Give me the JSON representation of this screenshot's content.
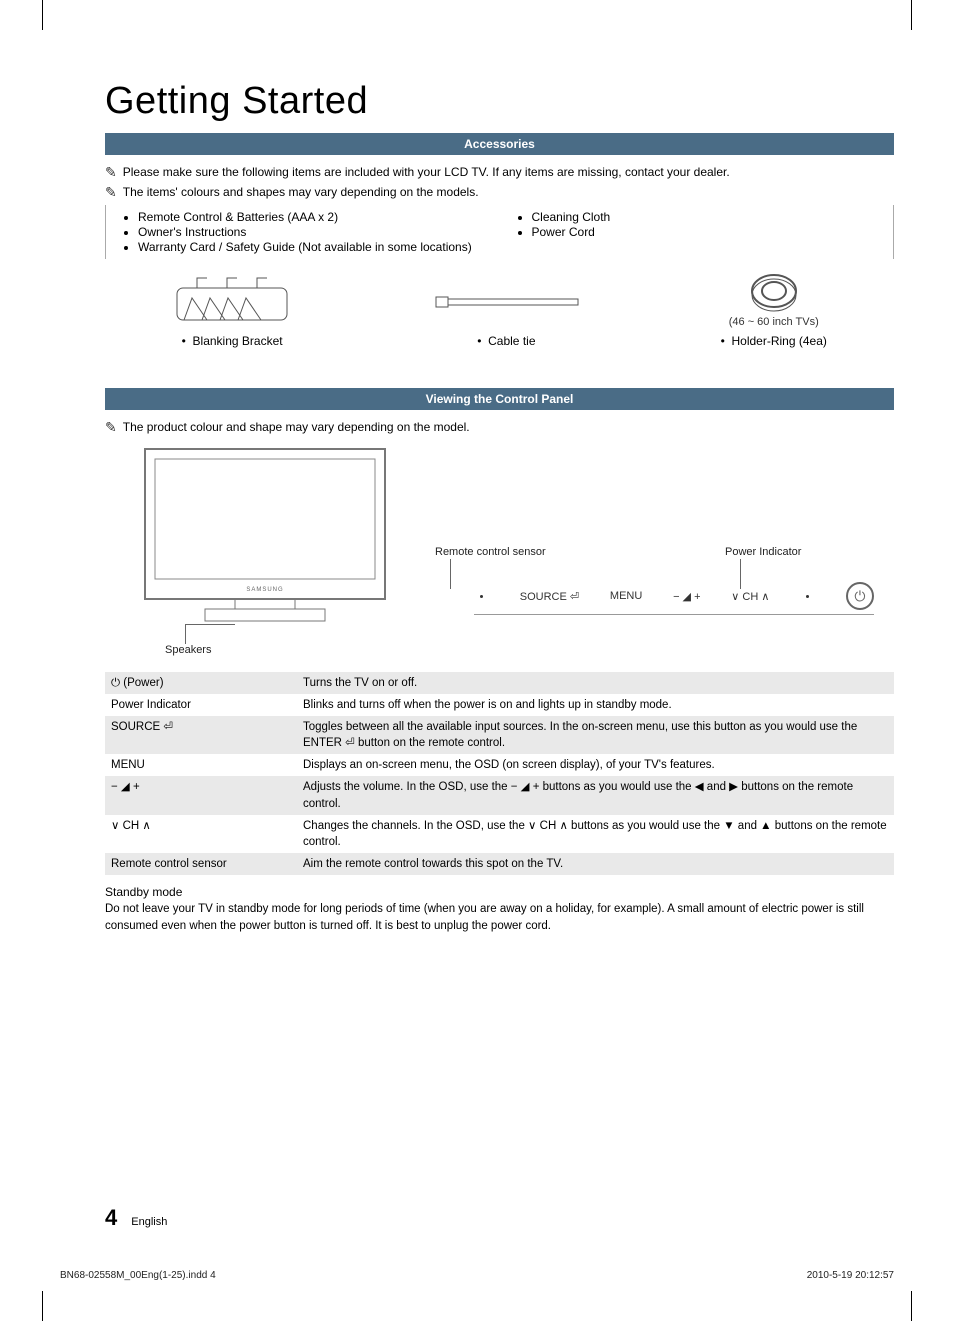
{
  "page_title": "Getting Started",
  "sections": {
    "accessories": {
      "heading": "Accessories",
      "notes": [
        "Please make sure the following items are included with your LCD TV. If any items are missing, contact your dealer.",
        "The items' colours and shapes may vary depending on the models."
      ],
      "left_items": [
        "Remote Control & Batteries (AAA x 2)",
        "Owner's Instructions",
        "Warranty Card / Safety Guide (Not available in some locations)"
      ],
      "right_items": [
        "Cleaning Cloth",
        "Power Cord"
      ],
      "illustrations": [
        {
          "caption": "Blanking Bracket",
          "sub": ""
        },
        {
          "caption": "Cable tie",
          "sub": ""
        },
        {
          "caption": "Holder-Ring (4ea)",
          "sub": "(46 ~ 60 inch TVs)"
        }
      ]
    },
    "control_panel": {
      "heading": "Viewing the Control Panel",
      "note": "The product colour and shape may vary depending on the model.",
      "labels": {
        "remote_sensor": "Remote control sensor",
        "power_indicator": "Power Indicator",
        "speakers": "Speakers",
        "source": "SOURCE",
        "menu": "MENU",
        "ch": "CH"
      },
      "table": [
        {
          "label": "⏻ (Power)",
          "desc": "Turns the TV on or off."
        },
        {
          "label": "Power Indicator",
          "desc": "Blinks and turns off when the power is on and lights up in standby mode."
        },
        {
          "label": "SOURCE ⏎",
          "desc": "Toggles between all the available input sources. In the on-screen menu, use this button as you would use the ENTER ⏎ button on the remote control."
        },
        {
          "label": "MENU",
          "desc": "Displays an on-screen menu, the OSD (on screen display), of your TV's features."
        },
        {
          "label": "− ◢ +",
          "desc": "Adjusts the volume. In the OSD, use the − ◢ + buttons as you would use the ◀ and ▶ buttons on the remote control."
        },
        {
          "label": "∨ CH ∧",
          "desc": "Changes the channels. In the OSD, use the ∨ CH ∧ buttons as you would use the ▼ and ▲ buttons on the remote control."
        },
        {
          "label": "Remote control sensor",
          "desc": "Aim the remote control towards this spot on the TV."
        }
      ],
      "standby": {
        "heading": "Standby mode",
        "body": "Do not leave your TV in standby mode for long periods of time (when you are away on a holiday, for example). A small amount of electric power is still consumed even when the power button is turned off. It is best to unplug the power cord."
      }
    }
  },
  "footer": {
    "page_number": "4",
    "language": "English",
    "doc_id": "BN68-02558M_00Eng(1-25).indd   4",
    "timestamp": "2010-5-19   20:12:57"
  }
}
